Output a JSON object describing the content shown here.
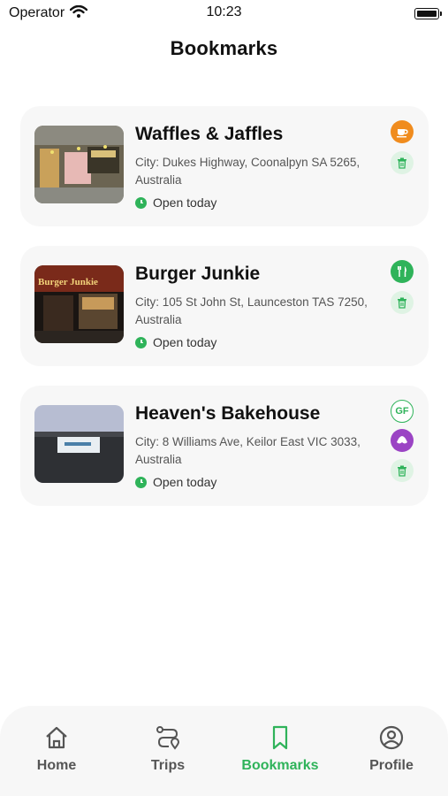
{
  "status": {
    "carrier": "Operator",
    "time": "10:23"
  },
  "header": {
    "title": "Bookmarks"
  },
  "bookmarks": [
    {
      "name": "Waffles & Jaffles",
      "address": "City: Dukes Highway, Coonalpyn SA 5265, Australia",
      "hours": "Open today",
      "category_icon": "coffee-cup-icon",
      "category_color": "#f08c1e"
    },
    {
      "name": "Burger Junkie",
      "address": "City: 105 St John St, Launceston TAS 7250, Australia",
      "hours": "Open today",
      "category_icon": "fork-knife-icon",
      "category_color": "#2fb35a"
    },
    {
      "name": "Heaven's Bakehouse",
      "address": "City: 8 Williams Ave, Keilor East VIC 3033, Australia",
      "hours": "Open today",
      "gf_label": "GF",
      "category_icon": "croissant-icon",
      "category_color": "#9b44c4"
    }
  ],
  "tabbar": {
    "items": [
      {
        "label": "Home",
        "icon": "home-icon"
      },
      {
        "label": "Trips",
        "icon": "route-icon"
      },
      {
        "label": "Bookmarks",
        "icon": "bookmark-icon",
        "active": true
      },
      {
        "label": "Profile",
        "icon": "profile-icon"
      }
    ],
    "active_color": "#2fb35a"
  }
}
